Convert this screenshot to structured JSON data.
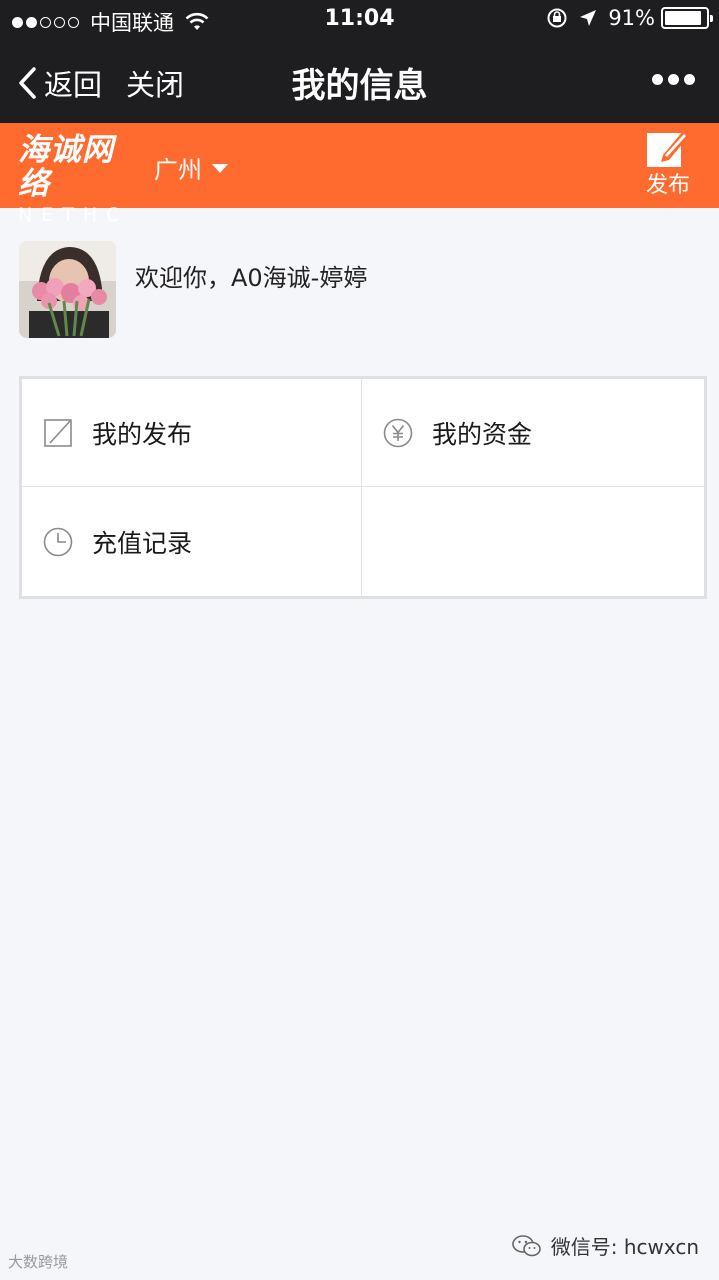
{
  "status_bar": {
    "carrier": "中国联通",
    "time": "11:04",
    "battery": "91%",
    "battery_level": 0.91,
    "signal_bars_filled": 2,
    "signal_bars_total": 5
  },
  "nav": {
    "back_label": "返回",
    "close_label": "关闭",
    "title": "我的信息"
  },
  "header": {
    "logo_cn": "海诚网络",
    "logo_en": "NETHC",
    "city": "广州",
    "publish_label": "发布",
    "accent_color": "#ff6a2e"
  },
  "user": {
    "welcome": "欢迎你，A0海诚-婷婷"
  },
  "menu": {
    "items": [
      {
        "label": "我的发布",
        "icon": "edit-square-icon"
      },
      {
        "label": "我的资金",
        "icon": "yen-circle-icon"
      },
      {
        "label": "充值记录",
        "icon": "clock-icon"
      }
    ]
  },
  "watermarks": {
    "left": "大数跨境",
    "right": "微信号: hcwxcn"
  }
}
